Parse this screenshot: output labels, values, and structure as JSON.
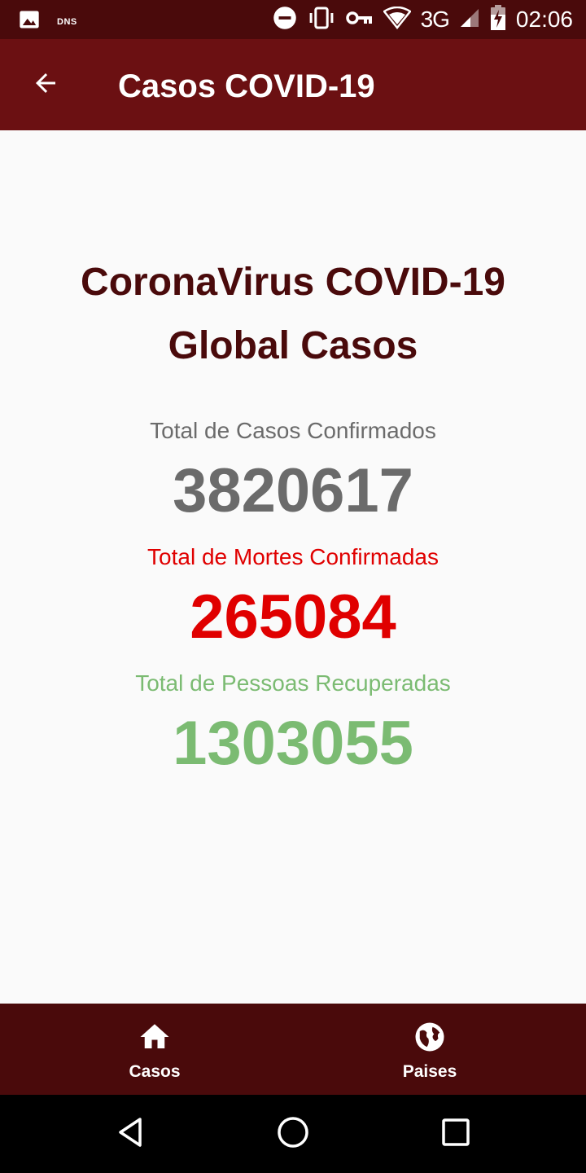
{
  "status_bar": {
    "dns_label": "DNS",
    "network": "3G",
    "time": "02:06",
    "icons": [
      "image-icon",
      "do-not-disturb-icon",
      "vibrate-icon",
      "vpn-key-icon",
      "wifi-icon",
      "signal-icon",
      "battery-charging-icon"
    ]
  },
  "app_bar": {
    "title": "Casos COVID-19",
    "back_icon": "arrow-back-icon"
  },
  "headline": {
    "line1": "CoronaVirus COVID-19",
    "line2": "Global Casos"
  },
  "stats": {
    "confirmed": {
      "label": "Total de Casos Confirmados",
      "value": "3820617",
      "color": "#6b6b6b"
    },
    "deaths": {
      "label": "Total de Mortes Confirmadas",
      "value": "265084",
      "color": "#e00000"
    },
    "recovered": {
      "label": "Total de Pessoas Recuperadas",
      "value": "1303055",
      "color": "#7bbb72"
    }
  },
  "bottom_nav": {
    "items": [
      {
        "label": "Casos",
        "icon": "home-icon"
      },
      {
        "label": "Paises",
        "icon": "globe-icon"
      }
    ]
  },
  "colors": {
    "status_bar": "#4a0a0b",
    "app_bar": "#6b1012",
    "bottom_nav": "#4a0a0b",
    "headline": "#4a0a0b"
  }
}
